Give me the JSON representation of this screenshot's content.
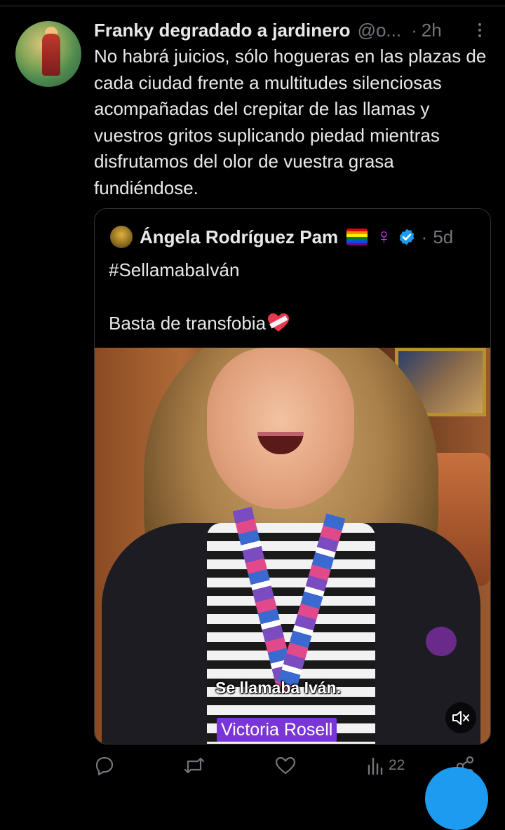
{
  "tweet": {
    "author_name": "Franky degradado a jardinero",
    "handle": "@o...",
    "separator": "·",
    "time": "2h",
    "text": "No habrá juicios, sólo hogueras en las plazas de cada ciudad frente a multitudes silenciosas acompañadas del crepitar de las llamas y vuestros gritos suplicando piedad mientras disfrutamos del olor de vuestra grasa fundiéndose."
  },
  "quoted_tweet": {
    "author_name": "Ángela Rodríguez Pam",
    "flag_icon": "rainbow-flag-icon",
    "symbol": "♀",
    "verified_icon": "verified-badge-icon",
    "separator": "·",
    "time": "5d",
    "line1": "#SellamabaIván",
    "line2": "Basta de transfobia",
    "heart_icon": "heart-bandage-icon",
    "video": {
      "caption": "Se llamaba Iván.",
      "name_label": "Victoria Rosell",
      "mute_icon": "volume-muted-icon"
    }
  },
  "actions": {
    "reply_icon": "reply-icon",
    "retweet_icon": "retweet-icon",
    "like_icon": "heart-icon",
    "views_icon": "views-icon",
    "views_count": "22",
    "share_icon": "share-icon"
  },
  "colors": {
    "background": "#000000",
    "text": "#e7e9ea",
    "muted": "#71767b",
    "border": "#2f3336",
    "verified": "#1d9bf0",
    "name_label_bg": "#7a35d6"
  }
}
